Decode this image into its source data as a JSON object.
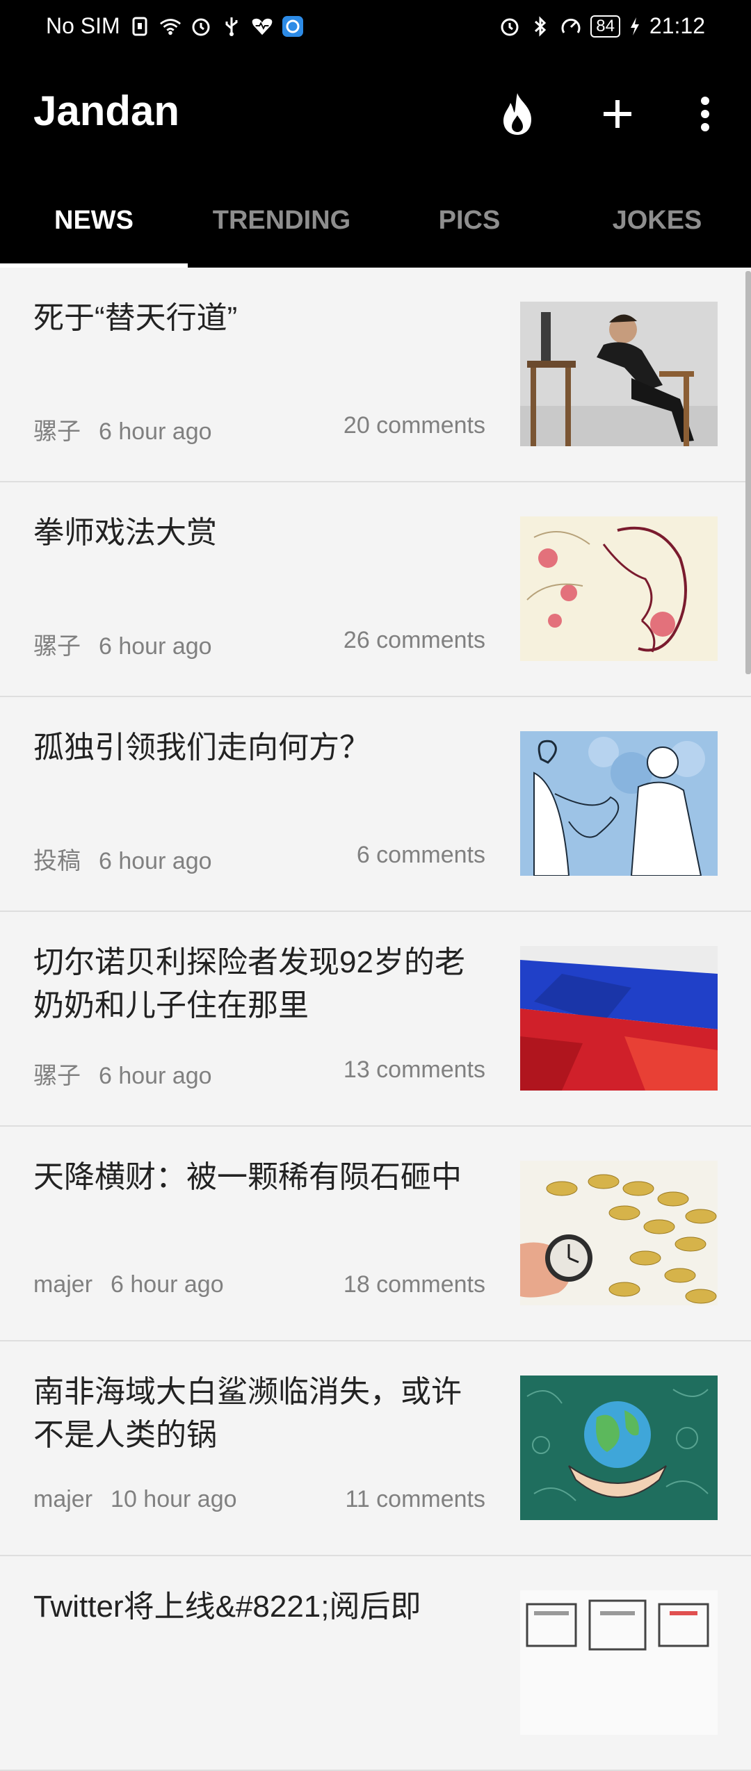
{
  "status_bar": {
    "carrier": "No SIM",
    "battery": "84",
    "time": "21:12"
  },
  "app": {
    "title": "Jandan",
    "actions": [
      "flame-icon",
      "add-icon",
      "more-vert-icon"
    ]
  },
  "tabs": [
    {
      "label": "NEWS",
      "active": true
    },
    {
      "label": "TRENDING",
      "active": false
    },
    {
      "label": "PICS",
      "active": false
    },
    {
      "label": "JOKES",
      "active": false
    }
  ],
  "articles": [
    {
      "title": "死于“替天行道”",
      "author": "骡子",
      "time": "6 hour ago",
      "comments": "20 comments"
    },
    {
      "title": "拳师戏法大赏",
      "author": "骡子",
      "time": "6 hour ago",
      "comments": "26 comments"
    },
    {
      "title": "孤独引领我们走向何方？",
      "author": "投稿",
      "time": "6 hour ago",
      "comments": "6 comments"
    },
    {
      "title": "切尔诺贝利探险者发现92岁的老奶奶和儿子住在那里",
      "author": "骡子",
      "time": "6 hour ago",
      "comments": "13 comments"
    },
    {
      "title": "天降横财：被一颗稀有陨石砸中",
      "author": "majer",
      "time": "6 hour ago",
      "comments": "18 comments"
    },
    {
      "title": "南非海域大白鲨濒临消失，或许不是人类的锅",
      "author": "majer",
      "time": "10 hour ago",
      "comments": "11 comments"
    },
    {
      "title": "Twitter将上线&#8221;阅后即",
      "author": "",
      "time": "",
      "comments": ""
    }
  ]
}
